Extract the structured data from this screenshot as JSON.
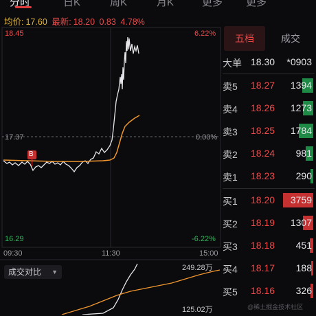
{
  "tabs": [
    {
      "label": "分时"
    },
    {
      "label": "日K"
    },
    {
      "label": "周K"
    },
    {
      "label": "月K"
    },
    {
      "label": "更多"
    },
    {
      "label": "更多"
    }
  ],
  "stats": {
    "avg_label": "均价:",
    "avg_value": "17.60",
    "latest_label": "最新:",
    "latest_value": "18.20",
    "change": "0.83",
    "change_pct": "4.78%"
  },
  "axis": {
    "price_high": "18.45",
    "price_ref": "17.37",
    "price_low": "16.29",
    "pct_high": "6.22%",
    "pct_ref": "0.00%",
    "pct_low": "-6.22%",
    "time_start": "09:30",
    "time_mid": "11:30",
    "time_end": "15:00"
  },
  "marker": {
    "label": "B"
  },
  "volume": {
    "selector_label": "成交对比",
    "high": "249.28万",
    "mid": "125.02万"
  },
  "order_book": {
    "tabs": {
      "active": "五档",
      "inactive": "成交"
    },
    "big_order": {
      "label": "大单",
      "price": "18.30",
      "volume": "*0903"
    },
    "asks": [
      {
        "label": "卖5",
        "price": "18.27",
        "volume": "1394",
        "fill": 0.37
      },
      {
        "label": "卖4",
        "price": "18.26",
        "volume": "1273",
        "fill": 0.34
      },
      {
        "label": "卖3",
        "price": "18.25",
        "volume": "1784",
        "fill": 0.47
      },
      {
        "label": "卖2",
        "price": "18.24",
        "volume": "981",
        "fill": 0.26
      },
      {
        "label": "卖1",
        "price": "18.23",
        "volume": "290",
        "fill": 0.08
      }
    ],
    "bids": [
      {
        "label": "买1",
        "price": "18.20",
        "volume": "3759",
        "fill": 1.0
      },
      {
        "label": "买2",
        "price": "18.19",
        "volume": "1307",
        "fill": 0.35
      },
      {
        "label": "买3",
        "price": "18.18",
        "volume": "451",
        "fill": 0.12
      },
      {
        "label": "买4",
        "price": "18.17",
        "volume": "188",
        "fill": 0.05
      },
      {
        "label": "买5",
        "price": "18.16",
        "volume": "326",
        "fill": 0.09
      }
    ]
  },
  "watermark": "@稀土掘金技术社区",
  "colors": {
    "up": "#ea4b4b",
    "down": "#2fb35a",
    "price_line": "#e6e6ea",
    "avg_line": "#f0962e",
    "accent": "#e23b3b"
  }
}
